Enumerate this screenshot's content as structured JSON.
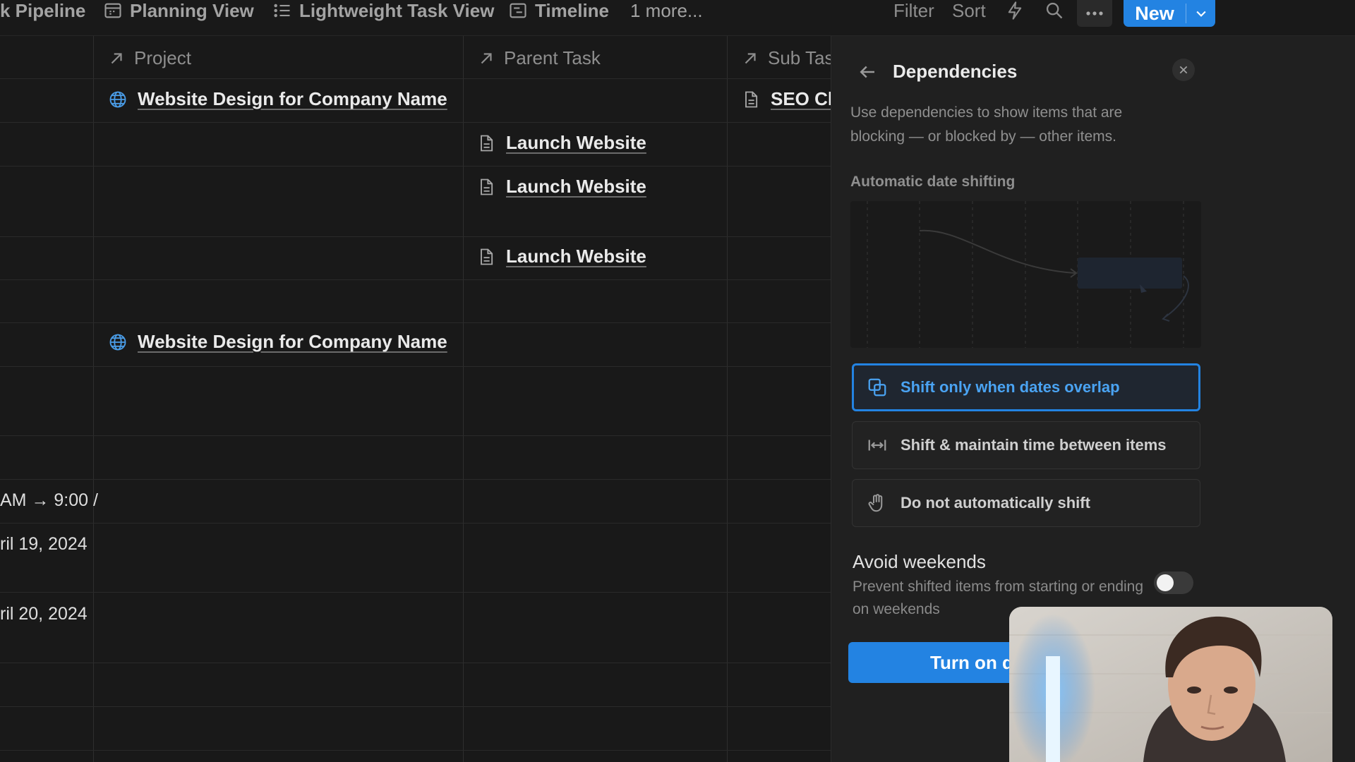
{
  "viewbar": {
    "tabs": [
      {
        "label": "k Pipeline",
        "icon": "none"
      },
      {
        "label": "Planning View",
        "icon": "calendar-icon"
      },
      {
        "label": "Lightweight Task View",
        "icon": "list-icon"
      },
      {
        "label": "Timeline",
        "icon": "timeline-icon"
      }
    ],
    "more_label": "1 more...",
    "filter_label": "Filter",
    "sort_label": "Sort",
    "new_label": "New"
  },
  "table": {
    "columns": [
      "Project",
      "Parent Task",
      "Sub Tas"
    ],
    "rows": [
      {
        "project": "Website Design for Company Name",
        "parent_task": "",
        "sub_task": "SEO Ch"
      },
      {
        "project": "",
        "parent_task": "Launch Website",
        "sub_task": ""
      },
      {
        "project": "",
        "parent_task": "Launch Website",
        "sub_task": ""
      },
      {
        "project": "",
        "parent_task": "Launch Website",
        "sub_task": ""
      },
      {
        "project": "Website Design for Company Name",
        "parent_task": "",
        "sub_task": ""
      }
    ],
    "dates": [
      "AM → 9:00 /",
      "ril 19, 2024",
      "ril 20, 2024"
    ]
  },
  "panel": {
    "title": "Dependencies",
    "description": "Use dependencies to show items that are blocking — or blocked by — other items.",
    "subheading": "Automatic date shifting",
    "options": [
      {
        "label": "Shift only when dates overlap",
        "icon": "overlap-icon",
        "selected": true
      },
      {
        "label": "Shift & maintain time between items",
        "icon": "arrows-between-icon",
        "selected": false
      },
      {
        "label": "Do not automatically shift",
        "icon": "hand-icon",
        "selected": false
      }
    ],
    "avoid_weekends": {
      "title": "Avoid weekends",
      "description": "Prevent shifted items from starting or ending on weekends",
      "enabled": false
    },
    "turn_on_label": "Turn on d"
  },
  "colors": {
    "background": "#191919",
    "panel": "#202020",
    "accent": "#2383e2"
  }
}
